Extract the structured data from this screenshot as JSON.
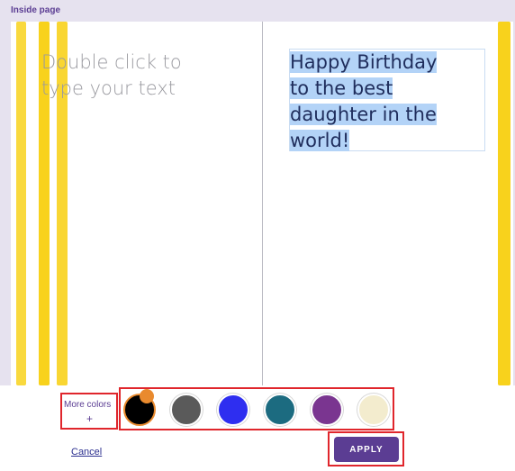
{
  "header": {
    "title": "Inside page"
  },
  "card": {
    "left_placeholder": "Double click to type your text",
    "right_text_lines": [
      "Happy Birthday",
      "to the best",
      "daughter in the",
      "world!"
    ]
  },
  "palette": {
    "more_colors_label": "More colors",
    "more_colors_plus": "+",
    "swatches": [
      {
        "color": "#000000",
        "selected": true
      },
      {
        "color": "#5a5a5a",
        "selected": false
      },
      {
        "color": "#2e2ef0",
        "selected": false
      },
      {
        "color": "#1c6b80",
        "selected": false
      },
      {
        "color": "#7a3590",
        "selected": false
      },
      {
        "color": "#f3ecce",
        "selected": false
      }
    ]
  },
  "actions": {
    "cancel_label": "Cancel",
    "apply_label": "APPLY"
  },
  "colors": {
    "accent": "#5b3d93",
    "highlight": "#e0262c",
    "stripe": "#f8d21c",
    "selection": "#b3d3f7"
  }
}
